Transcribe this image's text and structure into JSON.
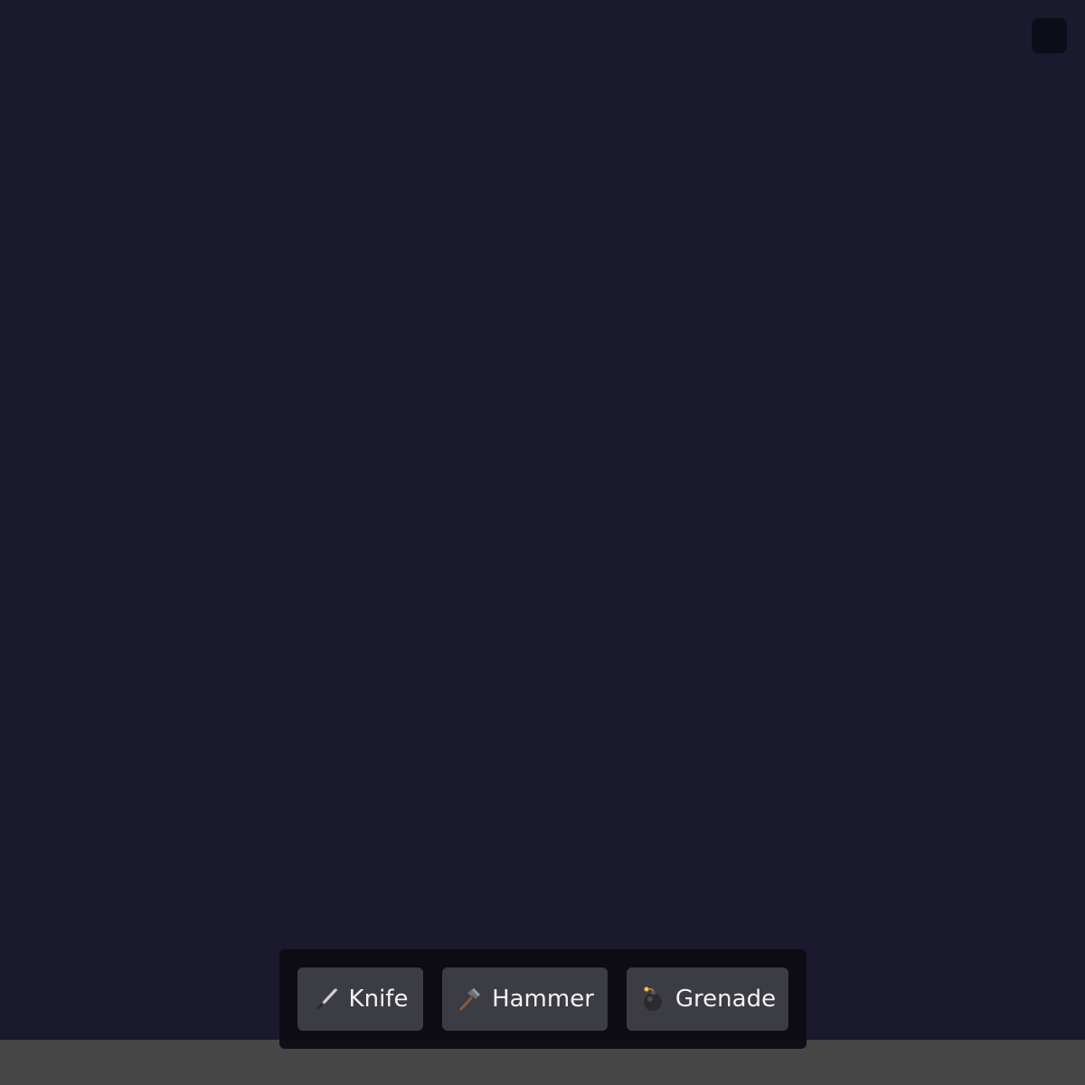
{
  "toolbar": {
    "items": [
      {
        "label": "Knife",
        "icon": "knife-icon"
      },
      {
        "label": "Hammer",
        "icon": "hammer-icon"
      },
      {
        "label": "Grenade",
        "icon": "bomb-icon"
      }
    ]
  },
  "colors": {
    "background": "#1b192e",
    "ground": "#464646",
    "toolbar": "#0c0b14",
    "button": "#3c3c44",
    "text": "#f2f2f2"
  }
}
